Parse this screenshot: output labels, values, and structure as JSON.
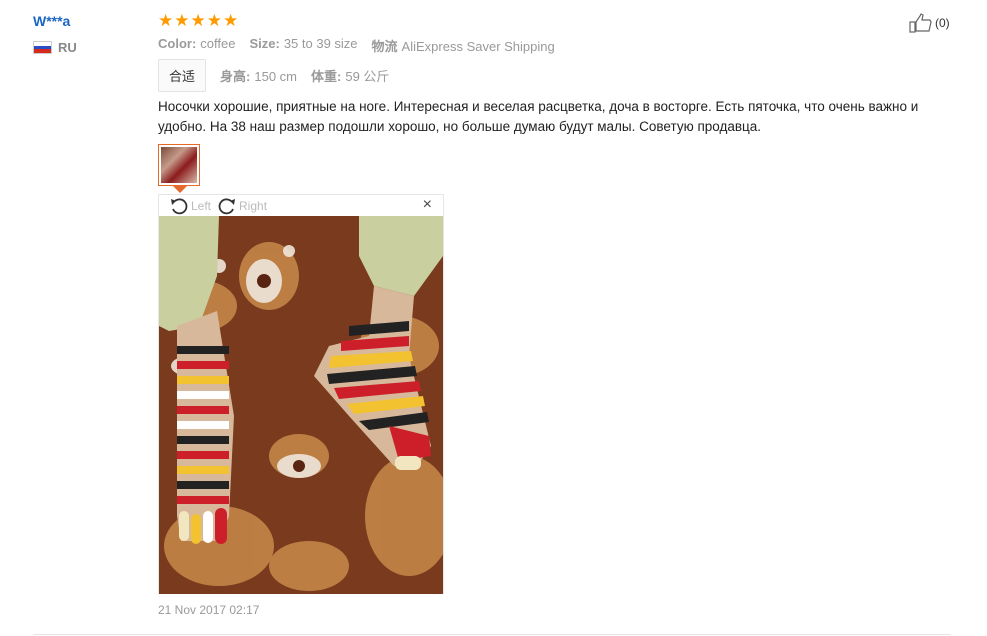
{
  "user": {
    "name": "W***a",
    "country": "RU"
  },
  "rating": {
    "stars": 5,
    "star_glyph": "★",
    "color": "#ff9a00"
  },
  "attributes": [
    {
      "key": "Color:",
      "value": "coffee"
    },
    {
      "key": "Size:",
      "value": "35 to 39 size"
    },
    {
      "key": "物流",
      "value": "AliExpress Saver Shipping"
    }
  ],
  "fit": {
    "badge": "合适",
    "height_key": "身高:",
    "height_value": "150 cm",
    "weight_key": "体重:",
    "weight_value": "59 公斤"
  },
  "review": {
    "text": "Носочки хорошие, приятные на ноге. Интересная и веселая расцветка, доча в восторге. Есть пяточка, что очень важно и удобно. На 38 наш размер подошли хорошо, но больше думаю будут малы. Советую продавца.",
    "date": "21 Nov 2017 02:17"
  },
  "viewer": {
    "rotate_left_label": "Left",
    "rotate_right_label": "Right",
    "close_glyph": "×"
  },
  "helpful": {
    "count": "(0)"
  },
  "colors": {
    "username": "#1a66c4",
    "accent_orange": "#e56a2a"
  },
  "icons": [
    "russia-flag-icon",
    "star-icon",
    "rotate-left-icon",
    "rotate-right-icon",
    "close-icon",
    "thumbs-up-icon"
  ]
}
